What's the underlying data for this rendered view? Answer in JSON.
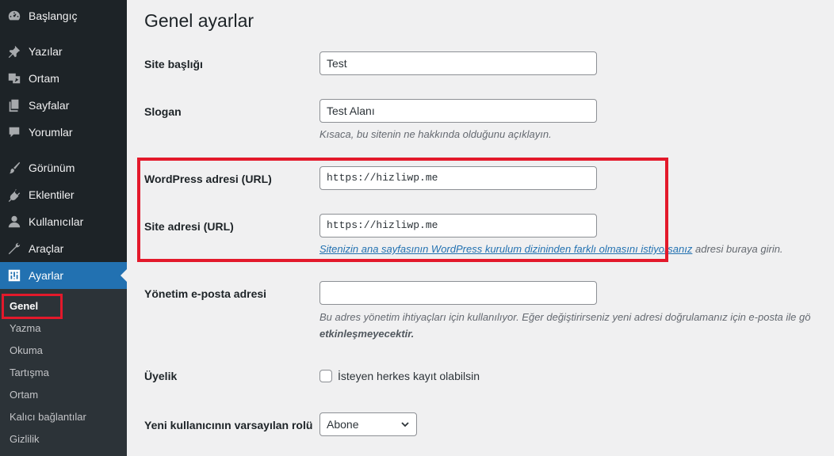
{
  "sidebar": {
    "items": [
      {
        "label": "Başlangıç",
        "icon": "dashboard-icon"
      },
      {
        "label": "Yazılar",
        "icon": "pushpin-icon"
      },
      {
        "label": "Ortam",
        "icon": "media-icon"
      },
      {
        "label": "Sayfalar",
        "icon": "pages-icon"
      },
      {
        "label": "Yorumlar",
        "icon": "comment-icon"
      },
      {
        "label": "Görünüm",
        "icon": "brush-icon"
      },
      {
        "label": "Eklentiler",
        "icon": "plugin-icon"
      },
      {
        "label": "Kullanıcılar",
        "icon": "user-icon"
      },
      {
        "label": "Araçlar",
        "icon": "wrench-icon"
      },
      {
        "label": "Ayarlar",
        "icon": "settings-icon"
      }
    ],
    "submenu": [
      "Genel",
      "Yazma",
      "Okuma",
      "Tartışma",
      "Ortam",
      "Kalıcı bağlantılar",
      "Gizlilik"
    ]
  },
  "main": {
    "title": "Genel ayarlar",
    "site_title": {
      "label": "Site başlığı",
      "value": "Test"
    },
    "tagline": {
      "label": "Slogan",
      "value": "Test Alanı",
      "desc": "Kısaca, bu sitenin ne hakkında olduğunu açıklayın."
    },
    "wp_address": {
      "label": "WordPress adresi (URL)",
      "value": "https://hizliwp.me"
    },
    "site_address": {
      "label": "Site adresi (URL)",
      "value": "https://hizliwp.me",
      "desc_link": "Sitenizin ana sayfasının WordPress kurulum dizininden farklı olmasını istiyorsanız",
      "desc_rest": " adresi buraya girin."
    },
    "admin_email": {
      "label": "Yönetim e-posta adresi",
      "value": "",
      "desc_line1": "Bu adres yönetim ihtiyaçları için kullanılıyor. Eğer değiştirirseniz yeni adresi doğrulamanız için e-posta ile gö",
      "desc_line2": "etkinleşmeyecektir."
    },
    "membership": {
      "label": "Üyelik",
      "checkbox_label": "İsteyen herkes kayıt olabilsin",
      "checked": false
    },
    "default_role": {
      "label": "Yeni kullanıcının varsayılan rolü",
      "value": "Abone"
    }
  },
  "colors": {
    "sidebar_bg": "#1d2327",
    "active": "#2271b1",
    "highlight": "#e3192b"
  }
}
